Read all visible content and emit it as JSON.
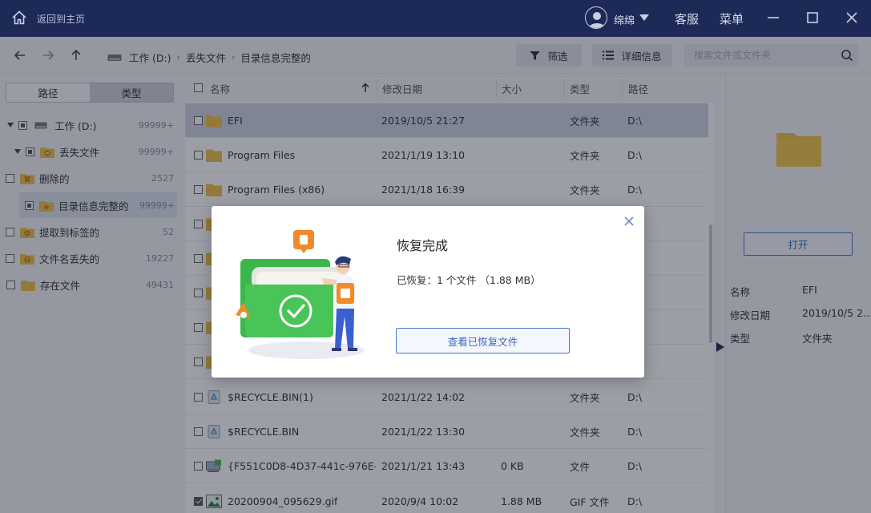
{
  "titlebar": {
    "home_label": "返回到主页",
    "username": "绵绵",
    "service": "客服",
    "menu": "菜单"
  },
  "toolbar": {
    "breadcrumb": [
      "工作 (D:)",
      "丢失文件",
      "目录信息完整的"
    ],
    "filter_label": "筛选",
    "details_label": "详细信息",
    "search_placeholder": "搜索文件或文件夹"
  },
  "left": {
    "tabs": [
      "路径",
      "类型"
    ],
    "tree": [
      {
        "label": "工作 (D:)",
        "count": "99999+"
      },
      {
        "label": "丢失文件",
        "count": "99999+"
      },
      {
        "label": "删除的",
        "count": "2527"
      },
      {
        "label": "目录信息完整的",
        "count": "99999+"
      },
      {
        "label": "提取到标签的",
        "count": "52"
      },
      {
        "label": "文件名丢失的",
        "count": "19227"
      },
      {
        "label": "存在文件",
        "count": "49431"
      }
    ]
  },
  "list": {
    "columns": {
      "name": "名称",
      "date": "修改日期",
      "size": "大小",
      "type": "类型",
      "path": "路径"
    },
    "rows": [
      {
        "name": "EFI",
        "date": "2019/10/5 21:27",
        "size": "",
        "type": "文件夹",
        "path": "D:\\"
      },
      {
        "name": "Program Files",
        "date": "2021/1/19 13:10",
        "size": "",
        "type": "文件夹",
        "path": "D:\\"
      },
      {
        "name": "Program Files (x86)",
        "date": "2021/1/18 16:39",
        "size": "",
        "type": "文件夹",
        "path": "D:\\"
      },
      {
        "name": "",
        "date": "",
        "size": "",
        "type": "",
        "path": ""
      },
      {
        "name": "",
        "date": "",
        "size": "",
        "type": "",
        "path": ""
      },
      {
        "name": "",
        "date": "",
        "size": "",
        "type": "",
        "path": ""
      },
      {
        "name": "",
        "date": "",
        "size": "",
        "type": "",
        "path": ""
      },
      {
        "name": "",
        "date": "",
        "size": "",
        "type": "",
        "path": ""
      },
      {
        "name": "$RECYCLE.BIN(1)",
        "date": "2021/1/22 14:02",
        "size": "",
        "type": "文件夹",
        "path": "D:\\"
      },
      {
        "name": "$RECYCLE.BIN",
        "date": "2021/1/22 13:30",
        "size": "",
        "type": "文件夹",
        "path": "D:\\"
      },
      {
        "name": "{F551C0D8-4D37-441c-976E-...",
        "date": "2021/1/21 13:43",
        "size": "0 KB",
        "type": "文件",
        "path": "D:\\"
      },
      {
        "name": "20200904_095629.gif",
        "date": "2020/9/4 10:02",
        "size": "1.88 MB",
        "type": "GIF 文件",
        "path": "D:\\"
      }
    ]
  },
  "right": {
    "open_label": "打开",
    "props": [
      {
        "k": "名称",
        "v": "EFI"
      },
      {
        "k": "修改日期",
        "v": "2019/10/5 2..."
      },
      {
        "k": "类型",
        "v": "文件夹"
      }
    ]
  },
  "modal": {
    "title": "恢复完成",
    "text": "已恢复：1 个文件 （1.88 MB）",
    "button": "查看已恢复文件"
  },
  "colors": {
    "titlebar": "#1d2a57",
    "accent": "#4a78c9",
    "folder": "#f0c24b",
    "success_green": "#3cb64a"
  }
}
